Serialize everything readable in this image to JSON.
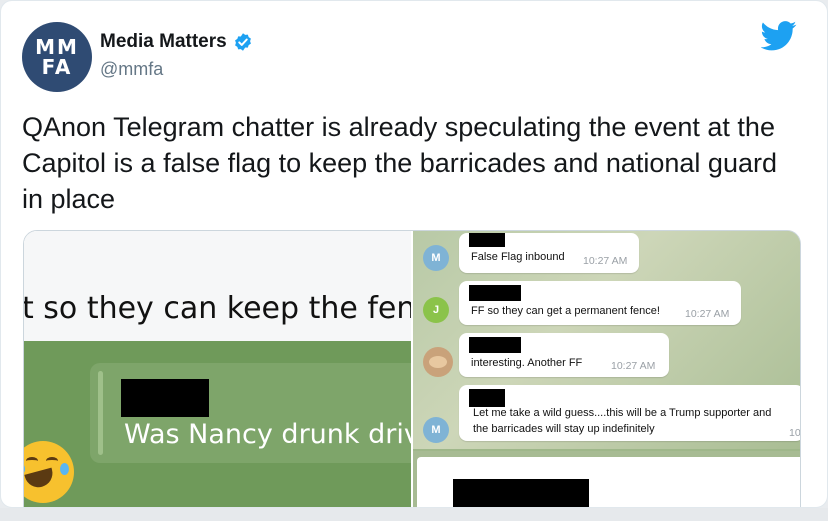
{
  "tweet": {
    "author_name": "Media Matters",
    "handle": "@mmfa",
    "avatar_text_line1": "MM",
    "avatar_text_line2": "FA",
    "text": "QAnon Telegram chatter is already speculating the event at the Capitol is a false flag to keep the barricades and national guard in place"
  },
  "media_left": {
    "fence_text": "t so they can keep the fence up",
    "quote_text": "Was Nancy drunk drivi"
  },
  "media_right": {
    "messages": [
      {
        "avatar": "M",
        "avatar_color": "#7fb3d5",
        "text": "False Flag inbound",
        "time": "10:27 AM"
      },
      {
        "avatar": "J",
        "avatar_color": "#8bc34a",
        "text": "FF so they can get a permanent fence!",
        "time": "10:27 AM"
      },
      {
        "avatar": "",
        "avatar_color": "#c9a27a",
        "text": "interesting.  Another FF",
        "time": "10:27 AM"
      },
      {
        "avatar": "M",
        "avatar_color": "#7fb3d5",
        "text": "Let me take a wild guess....this will be a Trump supporter and",
        "text2": "the barricades will stay up indefinitely",
        "time": "10"
      }
    ]
  },
  "colors": {
    "twitter_blue": "#1da1f2",
    "avatar_bg": "#2f4b73"
  }
}
